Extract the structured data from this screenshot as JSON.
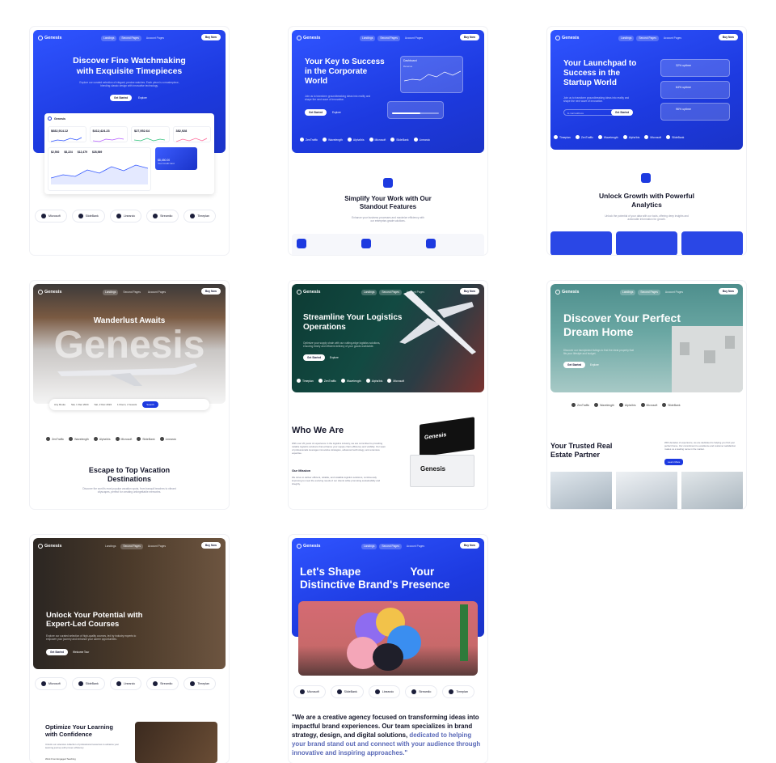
{
  "brand": "Genesis",
  "nav": {
    "landings": "Landings",
    "second_pages": "Second Pages",
    "account_pages": "Account Pages",
    "buy": "Buy Now"
  },
  "logos": [
    "Microsoft",
    "SlideBank",
    "Linearcic",
    "Streamlio",
    "Timeplan",
    "ZenTraffic",
    "Wavelength",
    "Alpha'bis"
  ],
  "cards": {
    "watch": {
      "title": "Discover Fine Watchmaking with Exquisite Timepieces",
      "sub": "Explore our curated selection of elegant, precise watches. Each piece is a masterpiece, blending classic design with innovative technology.",
      "cta1": "Get Started",
      "cta2": "Explore",
      "stats": [
        "$682,914.12",
        "$412,424.23",
        "$27,952.64",
        "382,928"
      ],
      "stats2": [
        "$2,592",
        "$8,224",
        "$12,479",
        "$28,569"
      ],
      "card_value": "$8,450.00",
      "card_label": "Your Credit Card"
    },
    "corporate": {
      "title": "Your Key to Success in the Corporate World",
      "sub": "Join us to transform groundbreaking ideas into reality and shape the next wave of innovation.",
      "cta1": "Get Started",
      "cta2": "Explore",
      "dashboard": "Dashboard",
      "revenue": "Revenue",
      "feature_title": "Simplify Your Work with Our Standout Features",
      "feature_sub": "Enhance your business processes and maximize efficiency with our enterprise-grade solutions."
    },
    "startup": {
      "title": "Your Launchpad to Success in the Startup World",
      "sub": "Join us to transform groundbreaking ideas into reality and shape the next wave of innovation.",
      "input": "E-mail address",
      "cta": "Get Started",
      "uptimes": [
        "32% uptime",
        "64% uptime",
        "96% uptime"
      ],
      "feature_title": "Unlock Growth with Powerful Analytics",
      "feature_sub": "Unlock the potential of your data with our tools, offering deep insights and actionable information for growth."
    },
    "travel": {
      "title": "Wanderlust Awaits",
      "bigword": "Genesis",
      "from": "Any Route",
      "date1": "Sat, 1 Dec 2024",
      "date2": "Sat, 2 Dec 2024",
      "guests": "1 Room, 2 Guests",
      "search": "Search",
      "section_title": "Escape to Top Vacation Destinations",
      "section_sub": "Discover the world's most popular vacation spots, from tranquil beaches to vibrant cityscapes, perfect for creating unforgettable memories."
    },
    "logistics": {
      "title": "Streamline Your Logistics Operations",
      "sub": "Optimize your supply chain with our cutting-edge logistics solutions, ensuring timely and efficient delivery of your goods worldwide.",
      "cta1": "Get Started",
      "cta2": "Explore",
      "who_title": "Who We Are",
      "who_text": "With over 20 years of experience in the logistics industry, we are committed to providing reliable logistics solutions that enhance your supply chain efficiency and visibility. Our team of professionals leverages innovative strategies, advanced technology, and extensive expertise.",
      "mission": "Our Mission",
      "mission_text": "We strive to deliver efficient, reliable, and scalable logistics solutions, continuously improving to meet the evolving needs of our clients while promoting sustainability and integrity."
    },
    "realestate": {
      "title": "Discover Your Perfect Dream Home",
      "sub": "Discover our handpicked listings to find the ideal property that fits your lifestyle and budget.",
      "cta1": "Get Started",
      "cta2": "Explore",
      "partner_title": "Your Trusted Real Estate Partner",
      "partner_text": "With decades of experience, we are dedicated to helping you find your perfect home. Our commitment to excellence and customer satisfaction makes us a leading name in the market.",
      "partner_cta": "Learn More"
    },
    "courses": {
      "title": "Unlock Your Potential with Expert-Led Courses",
      "sub": "Explore our curated selection of high-quality courses, led by industry experts to empower your journey and enhance your career opportunities.",
      "cta1": "Get Started",
      "cta2": "Welcome Tour",
      "opt_title": "Optimize Your Learning with Confidence",
      "opt_sub": "Unlock our extensive collection of professional resources to advance your learning journey with proven efficiency.",
      "opt_item": "Work From Engaged Teaching"
    },
    "agency": {
      "title_a": "Let's Shape",
      "title_b": "Your",
      "title_c": "Distinctive Brand's Presence",
      "quote_dark": "\"We are a creative agency focused on transforming ideas into impactful brand experiences. Our team specializes in brand strategy, design, and digital solutions,",
      "quote_blue": "dedicated to helping your brand stand out and connect with your audience through innovative and inspiring approaches.\""
    }
  },
  "colors": {
    "primary": "#1d3ae0",
    "dark": "#14162a",
    "muted": "#8a8ea3"
  }
}
